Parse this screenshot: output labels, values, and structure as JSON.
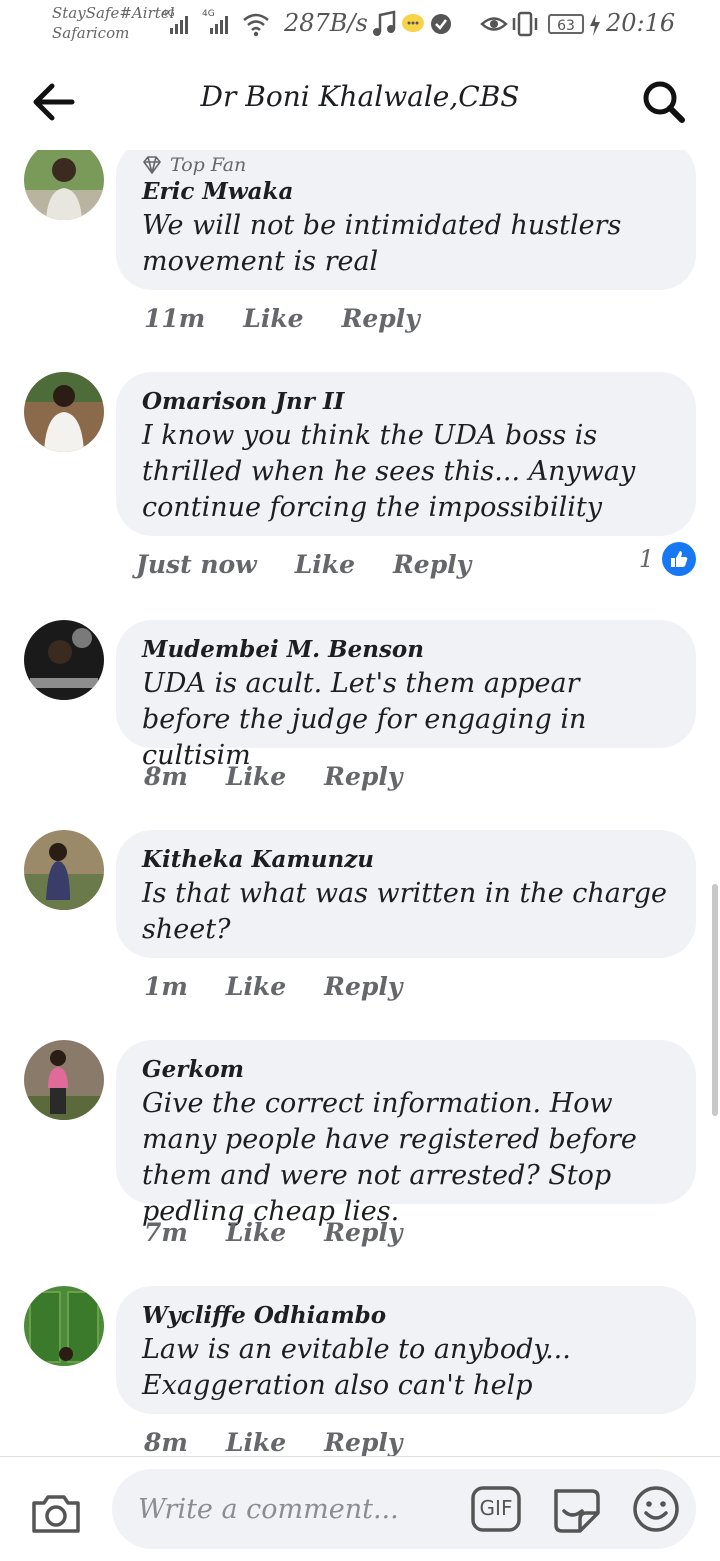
{
  "status_bar": {
    "carrier_line1": "StaySafe#Airtel",
    "carrier_line2": "Safaricom",
    "network1": "4G",
    "network2": "4G",
    "speed": "287B/s",
    "battery": "63",
    "time": "20:16"
  },
  "header": {
    "title": "Dr Boni Khalwale,CBS",
    "back_icon": "arrow-left-icon",
    "search_icon": "search-icon"
  },
  "comments": [
    {
      "badge": "Top Fan",
      "author": "Eric Mwaka",
      "text": "We will not be intimidated hustlers movement is real",
      "time": "11m",
      "like_label": "Like",
      "reply_label": "Reply"
    },
    {
      "author": "Omarison Jnr II",
      "text": "I know you think the UDA  boss is thrilled when he sees this... Anyway continue forcing the impossibility",
      "time": "Just now",
      "like_label": "Like",
      "reply_label": "Reply",
      "reaction_count": "1"
    },
    {
      "author": "Mudembei M. Benson",
      "text": "UDA is acult. Let's them appear before the judge for engaging in cultisim",
      "time": "8m",
      "like_label": "Like",
      "reply_label": "Reply"
    },
    {
      "author": "Kitheka Kamunzu",
      "text": "Is that what was written in the charge sheet?",
      "time": "1m",
      "like_label": "Like",
      "reply_label": "Reply"
    },
    {
      "author": "Gerkom",
      "text": "Give the correct information. How many people have registered before them and were not arrested? Stop pedling cheap lies.",
      "time": "7m",
      "like_label": "Like",
      "reply_label": "Reply"
    },
    {
      "author": "Wycliffe Odhiambo",
      "text": "Law is an evitable to anybody... Exaggeration also can't help",
      "time": "8m",
      "like_label": "Like",
      "reply_label": "Reply"
    }
  ],
  "composer": {
    "placeholder": "Write a comment...",
    "gif_label": "GIF"
  },
  "colors": {
    "bubble": "#f0f2f5",
    "like_blue": "#1877f2",
    "meta_gray": "#65676b"
  }
}
